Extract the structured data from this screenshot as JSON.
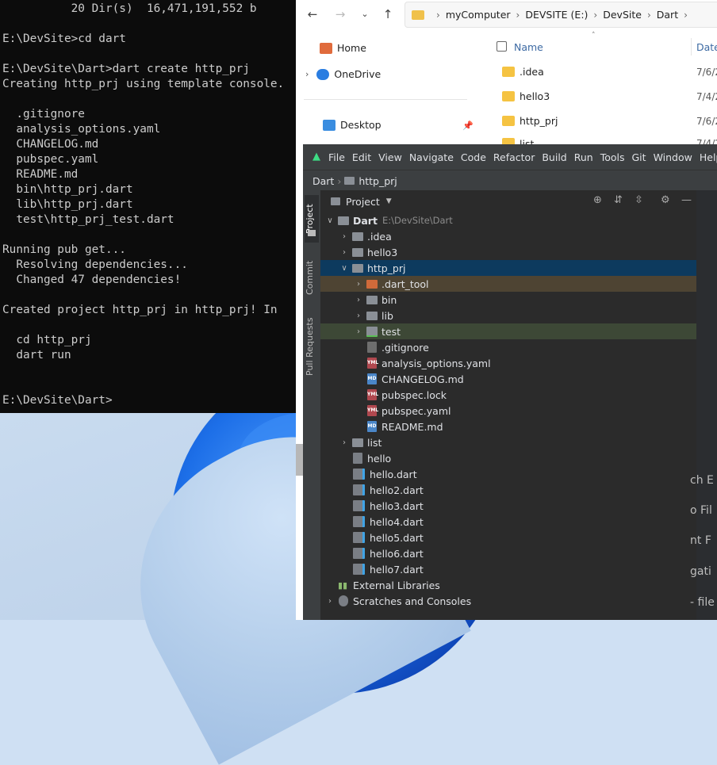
{
  "terminal": {
    "lines": "          20 Dir(s)  16,471,191,552 b\n\nE:\\DevSite>cd dart\n\nE:\\DevSite\\Dart>dart create http_prj\nCreating http_prj using template console.\n\n  .gitignore\n  analysis_options.yaml\n  CHANGELOG.md\n  pubspec.yaml\n  README.md\n  bin\\http_prj.dart\n  lib\\http_prj.dart\n  test\\http_prj_test.dart\n\nRunning pub get...\n  Resolving dependencies...\n  Changed 47 dependencies!\n\nCreated project http_prj in http_prj! In\n\n  cd http_prj\n  dart run\n\n\nE:\\DevSite\\Dart>"
  },
  "explorer": {
    "path": [
      "myComputer",
      "DEVSITE (E:)",
      "DevSite",
      "Dart"
    ],
    "nav": [
      "Home",
      "OneDrive",
      "Desktop"
    ],
    "column_name": "Name",
    "column_date": "Date",
    "rows": [
      {
        "name": ".idea",
        "date": "7/6/2"
      },
      {
        "name": "hello3",
        "date": "7/4/2"
      },
      {
        "name": "http_prj",
        "date": "7/6/2"
      },
      {
        "name": "list",
        "date": "7/4/2"
      }
    ]
  },
  "ide": {
    "menu": [
      "File",
      "Edit",
      "View",
      "Navigate",
      "Code",
      "Refactor",
      "Build",
      "Run",
      "Tools",
      "Git",
      "Window",
      "Help"
    ],
    "breadcrumb": [
      "Dart",
      "http_prj"
    ],
    "side_tabs": [
      "Project",
      "Commit",
      "Pull Requests"
    ],
    "panel_title": "Project",
    "root": {
      "name": "Dart",
      "path": "E:\\DevSite\\Dart"
    },
    "tree": [
      {
        "name": ".idea"
      },
      {
        "name": "hello3"
      },
      {
        "name": "http_prj"
      },
      {
        "name": ".dart_tool"
      },
      {
        "name": "bin"
      },
      {
        "name": "lib"
      },
      {
        "name": "test"
      },
      {
        "name": ".gitignore"
      },
      {
        "name": "analysis_options.yaml"
      },
      {
        "name": "CHANGELOG.md"
      },
      {
        "name": "pubspec.lock"
      },
      {
        "name": "pubspec.yaml"
      },
      {
        "name": "README.md"
      },
      {
        "name": "list"
      },
      {
        "name": "hello"
      },
      {
        "name": "hello.dart"
      },
      {
        "name": "hello2.dart"
      },
      {
        "name": "hello3.dart"
      },
      {
        "name": "hello4.dart"
      },
      {
        "name": "hello5.dart"
      },
      {
        "name": "hello6.dart"
      },
      {
        "name": "hello7.dart"
      },
      {
        "name": "External Libraries"
      },
      {
        "name": "Scratches and Consoles"
      }
    ],
    "right_partial": [
      "ch E",
      "o Fil",
      "nt F",
      "gati",
      "- file"
    ]
  }
}
